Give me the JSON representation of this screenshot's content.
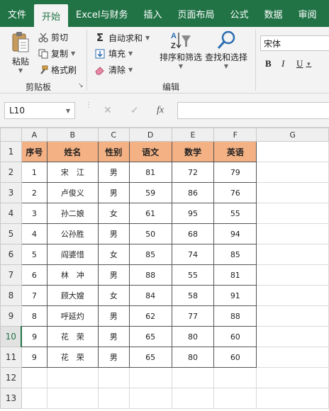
{
  "tabs": [
    "文件",
    "开始",
    "Excel与财务",
    "插入",
    "页面布局",
    "公式",
    "数据",
    "审阅"
  ],
  "active_tab_index": 1,
  "ribbon": {
    "paste_label": "粘贴",
    "cut_label": "剪切",
    "copy_label": "复制",
    "format_painter_label": "格式刷",
    "clipboard_group": "剪贴板",
    "autosum_label": "自动求和",
    "fill_label": "填充",
    "clear_label": "清除",
    "sort_filter_label": "排序和筛选",
    "find_select_label": "查找和选择",
    "editing_group": "编辑",
    "font_name": "宋体",
    "bold_label": "B",
    "italic_label": "I",
    "underline_label": "U"
  },
  "formula_bar": {
    "name_box": "L10",
    "cancel_glyph": "✕",
    "enter_glyph": "✓",
    "fx_label": "fx",
    "formula": ""
  },
  "columns": [
    "A",
    "B",
    "C",
    "D",
    "E",
    "F",
    "G"
  ],
  "row_numbers": [
    "1",
    "2",
    "3",
    "4",
    "5",
    "6",
    "7",
    "8",
    "9",
    "10",
    "11",
    "12",
    "13"
  ],
  "selected_row": "10",
  "table": {
    "headers": [
      "序号",
      "姓名",
      "性别",
      "语文",
      "数学",
      "英语"
    ],
    "rows": [
      [
        "1",
        "宋　江",
        "男",
        "81",
        "72",
        "79"
      ],
      [
        "2",
        "卢俊义",
        "男",
        "59",
        "86",
        "76"
      ],
      [
        "3",
        "孙二娘",
        "女",
        "61",
        "95",
        "55"
      ],
      [
        "4",
        "公孙胜",
        "男",
        "50",
        "68",
        "94"
      ],
      [
        "5",
        "阎婆惜",
        "女",
        "85",
        "74",
        "85"
      ],
      [
        "6",
        "林　冲",
        "男",
        "88",
        "55",
        "81"
      ],
      [
        "7",
        "顾大嫂",
        "女",
        "84",
        "58",
        "91"
      ],
      [
        "8",
        "呼延灼",
        "男",
        "62",
        "77",
        "88"
      ],
      [
        "9",
        "花　荣",
        "男",
        "65",
        "80",
        "60"
      ],
      [
        "9",
        "花　荣",
        "男",
        "65",
        "80",
        "60"
      ]
    ]
  },
  "colors": {
    "excel_green": "#217346",
    "header_fill": "#f4b183"
  }
}
